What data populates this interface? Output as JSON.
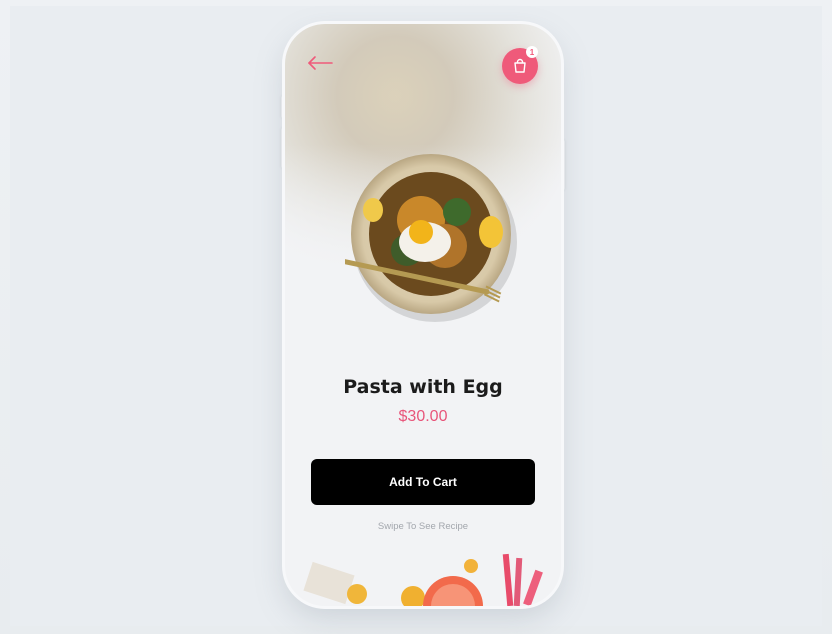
{
  "header": {
    "back_icon": "arrow-left-icon",
    "cart_icon": "shopping-bag-icon",
    "cart_count": "1"
  },
  "product": {
    "name": "Pasta with Egg",
    "price": "$30.00"
  },
  "actions": {
    "add_to_cart_label": "Add To Cart",
    "swipe_hint": "Swipe To See Recipe"
  },
  "colors": {
    "accent": "#ef5a7a",
    "price": "#e8557a",
    "button": "#000000",
    "background": "#e9edf1"
  }
}
